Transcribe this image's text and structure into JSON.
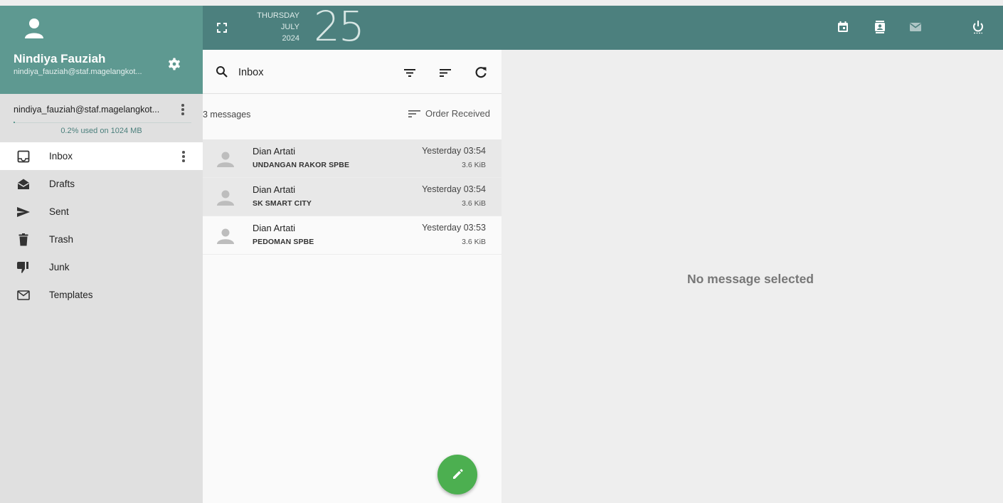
{
  "header": {
    "weekday": "THURSDAY",
    "month": "JULY",
    "year": "2024",
    "day": "25",
    "icons": [
      "fullscreen-icon",
      "calendar-icon",
      "contacts-icon",
      "mail-icon",
      "power-icon"
    ]
  },
  "profile": {
    "name": "Nindiya Fauziah",
    "email": "nindiya_fauziah@staf.magelangkot..."
  },
  "account": {
    "email": "nindiya_fauziah@staf.magelangkot...",
    "quota_text": "0.2% used on 1024 MB",
    "quota_used_percent": 0.2
  },
  "folders": [
    {
      "label": "Inbox",
      "icon": "inbox-icon",
      "active": true
    },
    {
      "label": "Drafts",
      "icon": "drafts-icon",
      "active": false
    },
    {
      "label": "Sent",
      "icon": "sent-icon",
      "active": false
    },
    {
      "label": "Trash",
      "icon": "trash-icon",
      "active": false
    },
    {
      "label": "Junk",
      "icon": "junk-icon",
      "active": false
    },
    {
      "label": "Templates",
      "icon": "templates-icon",
      "active": false
    }
  ],
  "search": {
    "value": "Inbox",
    "placeholder": ""
  },
  "list": {
    "count_text": "3 messages",
    "order_label": "Order Received",
    "messages": [
      {
        "sender": "Dian Artati",
        "subject": "UNDANGAN RAKOR SPBE",
        "date": "Yesterday 03:54",
        "size": "3.6 KiB",
        "read": true
      },
      {
        "sender": "Dian Artati",
        "subject": "SK SMART CITY",
        "date": "Yesterday 03:54",
        "size": "3.6 KiB",
        "read": true
      },
      {
        "sender": "Dian Artati",
        "subject": "PEDOMAN SPBE",
        "date": "Yesterday 03:53",
        "size": "3.6 KiB",
        "read": false
      }
    ]
  },
  "reader": {
    "empty_text": "No message selected"
  },
  "colors": {
    "topbar_left": "#5e9991",
    "topbar_main": "#4c807e",
    "fab": "#4caf50"
  }
}
